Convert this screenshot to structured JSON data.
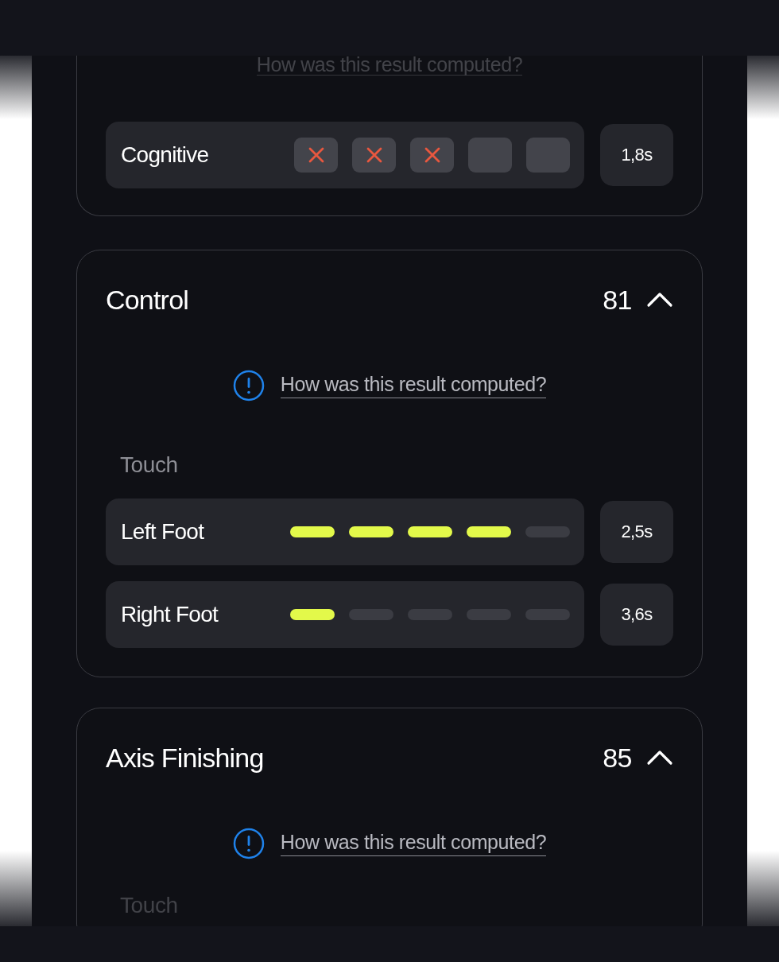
{
  "top_card": {
    "info_link": "How was this result computed?",
    "rows": [
      {
        "label": "Cognitive",
        "kind": "marks",
        "marks": [
          {
            "crossed": true
          },
          {
            "crossed": true
          },
          {
            "crossed": true
          },
          {
            "crossed": false
          },
          {
            "crossed": false
          }
        ],
        "reading": "1,8s"
      }
    ]
  },
  "cards": [
    {
      "title": "Control",
      "score": "81",
      "expanded": true,
      "info_link": "How was this result computed?",
      "section": "Touch",
      "rows": [
        {
          "label": "Left Foot",
          "kind": "bars",
          "bars": [
            {
              "filled": true
            },
            {
              "filled": true
            },
            {
              "filled": true
            },
            {
              "filled": true
            },
            {
              "filled": false
            }
          ],
          "reading": "2,5s"
        },
        {
          "label": "Right Foot",
          "kind": "bars",
          "bars": [
            {
              "filled": true
            },
            {
              "filled": false
            },
            {
              "filled": false
            },
            {
              "filled": false
            },
            {
              "filled": false
            }
          ],
          "reading": "3,6s"
        }
      ]
    },
    {
      "title": "Axis Finishing",
      "score": "85",
      "expanded": true,
      "info_link": "How was this result computed?",
      "section": "Touch"
    }
  ]
}
